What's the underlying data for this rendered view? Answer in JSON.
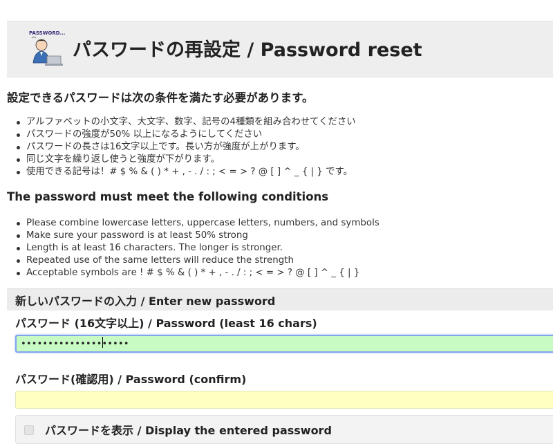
{
  "header": {
    "title": "パスワードの再設定 / Password reset",
    "logo_caption": "PASSWORD..."
  },
  "conditions_ja": {
    "heading": "設定できるパスワードは次の条件を満たす必要があります。",
    "items": [
      "アルファベットの小文字、大文字、数字、記号の4種類を組み合わせてください",
      "パスワードの強度が50% 以上になるようにしてください",
      "パスワードの長さは16文字以上です。長い方が強度が上がります。",
      "同じ文字を繰り返し使うと強度が下がります。",
      "使用できる記号は！# $ % & ( ) * + , - . / : ; < = > ? @ [ ] ^ _ { | } です。"
    ]
  },
  "conditions_en": {
    "heading": "The password must meet the following conditions",
    "items": [
      "Please combine lowercase letters, uppercase letters, numbers, and symbols",
      "Make sure your password is at least 50% strong",
      "Length is at least 16 characters. The longer is stronger.",
      "Repeated use of the same letters will reduce the strength",
      "Acceptable symbols are ! # $ % & ( ) * + , - . / : ; < = > ? @ [ ] ^ _ { | }"
    ]
  },
  "form": {
    "panel_title": "新しいパスワードの入力 / Enter new password",
    "password_label": "パスワード (16文字以上) / Password (least 16 chars)",
    "password_value": "••••••••••••••••••••",
    "confirm_label": "パスワード(確認用) / Password (confirm)",
    "confirm_value": "",
    "show_password_label": "パスワードを表示 / Display the entered password",
    "show_password_checked": false
  },
  "colors": {
    "header_bg": "#eeeeee",
    "password_field_bg": "#c8fbc4",
    "password_field_focus_border": "#80a4ee",
    "confirm_field_bg": "#ffffc0",
    "panel_heading_bg": "#ececec"
  }
}
